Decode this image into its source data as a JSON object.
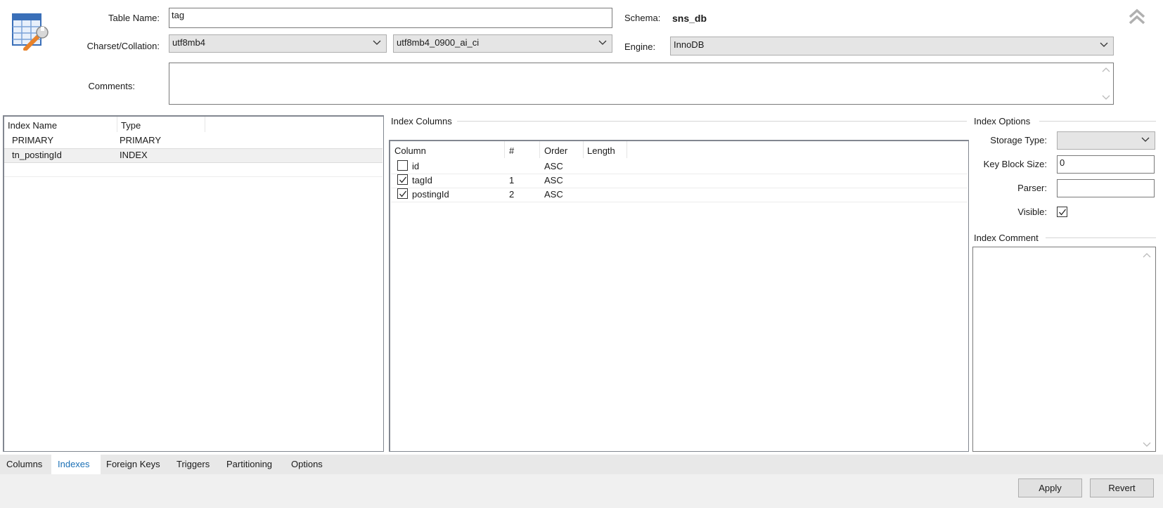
{
  "header": {
    "table_name_label": "Table Name:",
    "table_name_value": "tag",
    "schema_label": "Schema:",
    "schema_value": "sns_db",
    "charset_label": "Charset/Collation:",
    "charset_value": "utf8mb4",
    "collation_value": "utf8mb4_0900_ai_ci",
    "engine_label": "Engine:",
    "engine_value": "InnoDB",
    "comments_label": "Comments:",
    "comments_value": ""
  },
  "indexes": {
    "columns": [
      "Index Name",
      "Type"
    ],
    "rows": [
      {
        "name": "PRIMARY",
        "type": "PRIMARY"
      },
      {
        "name": "tn_postingId",
        "type": "INDEX"
      }
    ]
  },
  "index_columns": {
    "title": "Index Columns",
    "columns": [
      "Column",
      "#",
      "Order",
      "Length"
    ],
    "rows": [
      {
        "column": "id",
        "num": "",
        "order": "ASC",
        "length": "",
        "checked": false
      },
      {
        "column": "tagId",
        "num": "1",
        "order": "ASC",
        "length": "",
        "checked": true
      },
      {
        "column": "postingId",
        "num": "2",
        "order": "ASC",
        "length": "",
        "checked": true
      }
    ]
  },
  "index_options": {
    "title": "Index Options",
    "storage_type_label": "Storage Type:",
    "storage_type_value": "",
    "key_block_size_label": "Key Block Size:",
    "key_block_size_value": "0",
    "parser_label": "Parser:",
    "parser_value": "",
    "visible_label": "Visible:",
    "visible_checked": true,
    "comment_title": "Index Comment",
    "comment_value": ""
  },
  "tabs": [
    {
      "label": "Columns",
      "active": false
    },
    {
      "label": "Indexes",
      "active": true
    },
    {
      "label": "Foreign Keys",
      "active": false
    },
    {
      "label": "Triggers",
      "active": false
    },
    {
      "label": "Partitioning",
      "active": false
    },
    {
      "label": "Options",
      "active": false
    }
  ],
  "buttons": {
    "apply": "Apply",
    "revert": "Revert"
  },
  "colors": {
    "active_tab": "#1a6fb5",
    "tab_bar": "#e8e8e8",
    "selected_row": "#f0f0f0"
  },
  "icons": [
    "table-wrench-icon",
    "collapse-chevron-icon",
    "dropdown-arrow-icon",
    "checkbox-checked-icon",
    "scroll-up-icon",
    "scroll-down-icon"
  ]
}
